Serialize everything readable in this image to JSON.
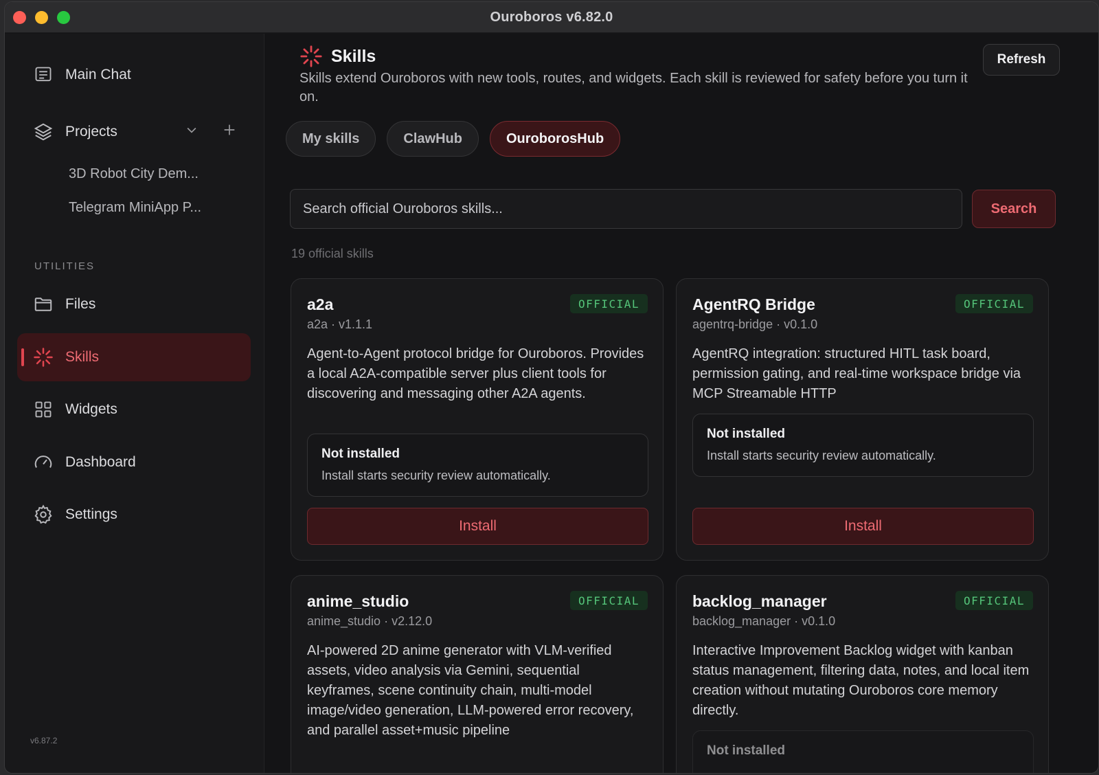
{
  "window": {
    "title": "Ouroboros v6.82.0"
  },
  "sidebar": {
    "main_chat": "Main Chat",
    "projects": "Projects",
    "project_items": [
      "3D Robot City Dem...",
      "Telegram MiniApp P..."
    ],
    "utilities_label": "UTILITIES",
    "files": "Files",
    "skills": "Skills",
    "widgets": "Widgets",
    "dashboard": "Dashboard",
    "settings": "Settings",
    "version": "v6.87.2"
  },
  "page": {
    "title": "Skills",
    "description": "Skills extend Ouroboros with new tools, routes, and widgets. Each skill is reviewed for safety before you turn it on.",
    "refresh": "Refresh",
    "tabs": [
      "My skills",
      "ClawHub",
      "OuroborosHub"
    ],
    "active_tab": "OuroborosHub"
  },
  "search": {
    "placeholder": "Search official Ouroboros skills...",
    "button": "Search",
    "count": "19 official skills"
  },
  "skills": [
    {
      "name": "a2a",
      "badge": "OFFICIAL",
      "meta": "a2a · v1.1.1",
      "description": "Agent-to-Agent protocol bridge for Ouroboros. Provides a local A2A-compatible server plus client tools for discovering and messaging other A2A agents.",
      "status_title": "Not installed",
      "status_text": "Install starts security review automatically.",
      "install": "Install"
    },
    {
      "name": "AgentRQ Bridge",
      "badge": "OFFICIAL",
      "meta": "agentrq-bridge · v0.1.0",
      "description": "AgentRQ integration: structured HITL task board, permission gating, and real-time workspace bridge via MCP Streamable HTTP",
      "status_title": "Not installed",
      "status_text": "Install starts security review automatically.",
      "install": "Install"
    },
    {
      "name": "anime_studio",
      "badge": "OFFICIAL",
      "meta": "anime_studio · v2.12.0",
      "description": "AI-powered 2D anime generator with VLM-verified assets, video analysis via Gemini, sequential keyframes, scene continuity chain, multi-model image/video generation, LLM-powered error recovery, and parallel asset+music pipeline"
    },
    {
      "name": "backlog_manager",
      "badge": "OFFICIAL",
      "meta": "backlog_manager · v0.1.0",
      "description": "Interactive Improvement Backlog widget with kanban status management, filtering data, notes, and local item creation without mutating Ouroboros core memory directly.",
      "status_title": "Not installed"
    }
  ],
  "colors": {
    "accent": "#e0454f",
    "official": "#55c57a",
    "background": "#141416"
  }
}
